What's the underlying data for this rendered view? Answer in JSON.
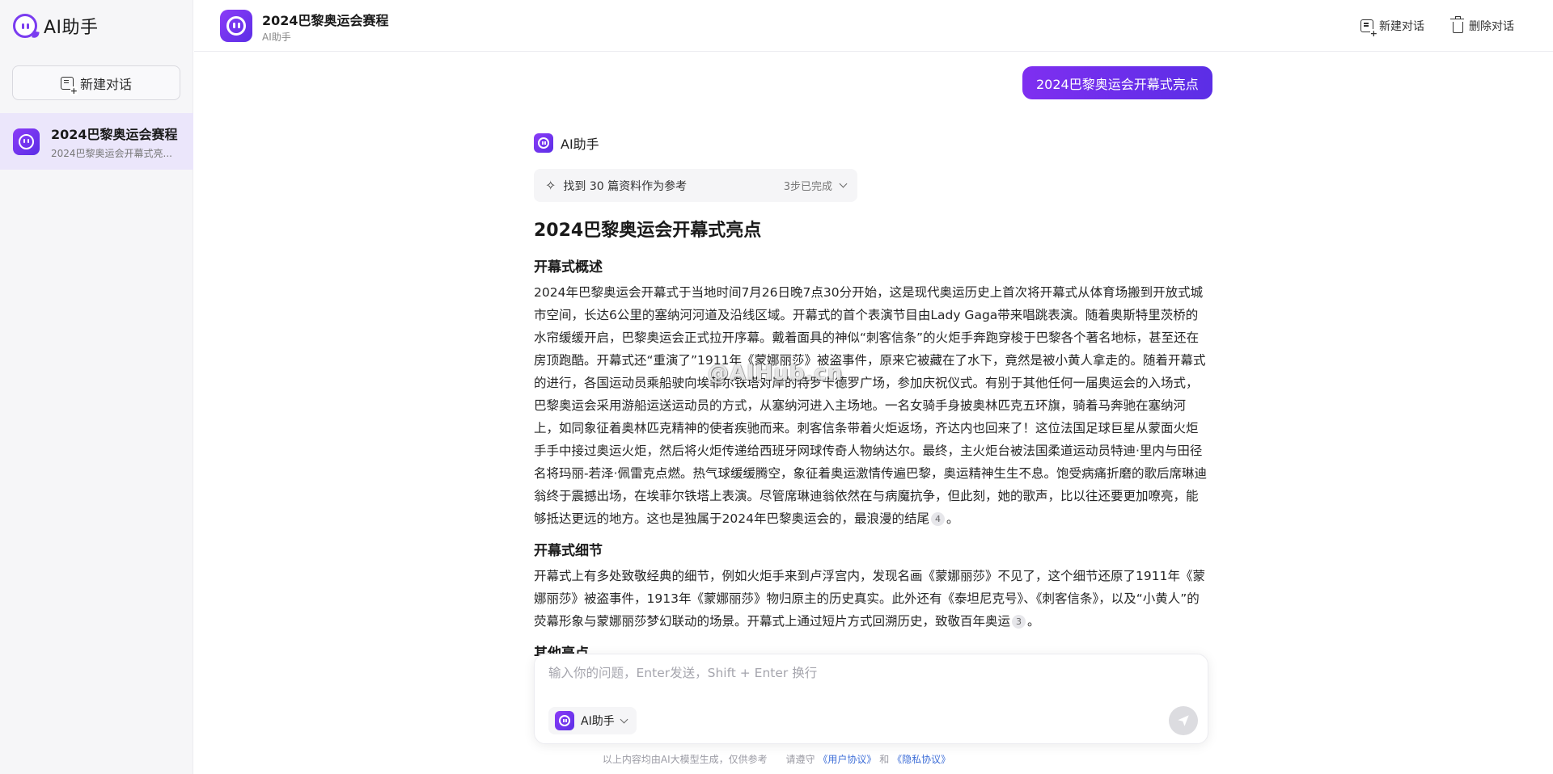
{
  "sidebar": {
    "brand": "AI助手",
    "new_chat": "新建对话",
    "conversation": {
      "title": "2024巴黎奥运会赛程",
      "subtitle": "2024巴黎奥运会开幕式亮..."
    }
  },
  "header": {
    "title": "2024巴黎奥运会赛程",
    "subtitle": "AI助手",
    "new_chat": "新建对话",
    "delete_chat": "删除对话"
  },
  "user_message": "2024巴黎奥运会开幕式亮点",
  "assistant": {
    "name": "AI助手",
    "references": "找到 30 篇资料作为参考",
    "steps": "3步已完成",
    "title": "2024巴黎奥运会开幕式亮点",
    "sections": [
      {
        "heading": "开幕式概述",
        "text": "2024年巴黎奥运会开幕式于当地时间7月26日晚7点30分开始，这是现代奥运历史上首次将开幕式从体育场搬到开放式城市空间，长达6公里的塞纳河河道及沿线区域。开幕式的首个表演节目由Lady Gaga带来唱跳表演。随着奥斯特里茨桥的水帘缓缓开启，巴黎奥运会正式拉开序幕。戴着面具的神似“刺客信条”的火炬手奔跑穿梭于巴黎各个著名地标，甚至还在房顶跑酷。开幕式还“重演了”1911年《蒙娜丽莎》被盗事件，原来它被藏在了水下，竟然是被小黄人拿走的。随着开幕式的进行，各国运动员乘船驶向埃菲尔铁塔对岸的特罗卡德罗广场，参加庆祝仪式。有别于其他任何一届奥运会的入场式，巴黎奥运会采用游船运送运动员的方式，从塞纳河进入主场地。一名女骑手身披奥林匹克五环旗，骑着马奔驰在塞纳河上，如同象征着奥林匹克精神的使者疾驰而来。刺客信条带着火炬返场，齐达内也回来了！这位法国足球巨星从蒙面火炬手手中接过奥运火炬，然后将火炬传递给西班牙网球传奇人物纳达尔。最终，主火炬台被法国柔道运动员特迪·里内与田径名将玛丽-若泽·佩雷克点燃。热气球缓缓腾空，象征着奥运激情传遍巴黎，奥运精神生生不息。饱受病痛折磨的歌后席琳迪翁终于震撼出场，在埃菲尔铁塔上表演。尽管席琳迪翁依然在与病魔抗争，但此刻，她的歌声，比以往还要更加嘹亮，能够抵达更远的地方。这也是独属于2024年巴黎奥运会的，最浪漫的结尾",
        "cite": "4",
        "end": "。"
      },
      {
        "heading": "开幕式细节",
        "text": "开幕式上有多处致敬经典的细节，例如火炬手来到卢浮宫内，发现名画《蒙娜丽莎》不见了，这个细节还原了1911年《蒙娜丽莎》被盗事件，1913年《蒙娜丽莎》物归原主的历史真实。此外还有《泰坦尼克号》、《刺客信条》，以及“小黄人”的荧幕形象与蒙娜丽莎梦幻联动的场景。开幕式上通过短片方式回溯历史，致敬百年奥运",
        "cite": "3",
        "end": "。"
      },
      {
        "heading": "其他亮点",
        "text": "",
        "cite": "",
        "end": ""
      }
    ]
  },
  "watermark": "@AIHub.cn",
  "input": {
    "placeholder": "输入你的问题，Enter发送，Shift + Enter 换行",
    "value": "",
    "model": "AI助手"
  },
  "footer": {
    "disclaimer": "以上内容均由AI大模型生成，仅供参考",
    "follow": "请遵守",
    "user_agreement": "《用户协议》",
    "and": "和",
    "privacy": "《隐私协议》"
  },
  "colors": {
    "accent": "#7a3cf0",
    "bubble_start": "#7f2ff0",
    "bubble_end": "#5b2ee6",
    "selected_bg": "#ebe6fb",
    "link": "#3f6fd8"
  },
  "icons": {
    "brand": "ai-logo-icon",
    "new_chat": "new-chat-icon",
    "delete": "trash-icon",
    "sparkle": "sparkle-icon",
    "chevron": "chevron-down-icon",
    "send": "send-icon"
  }
}
